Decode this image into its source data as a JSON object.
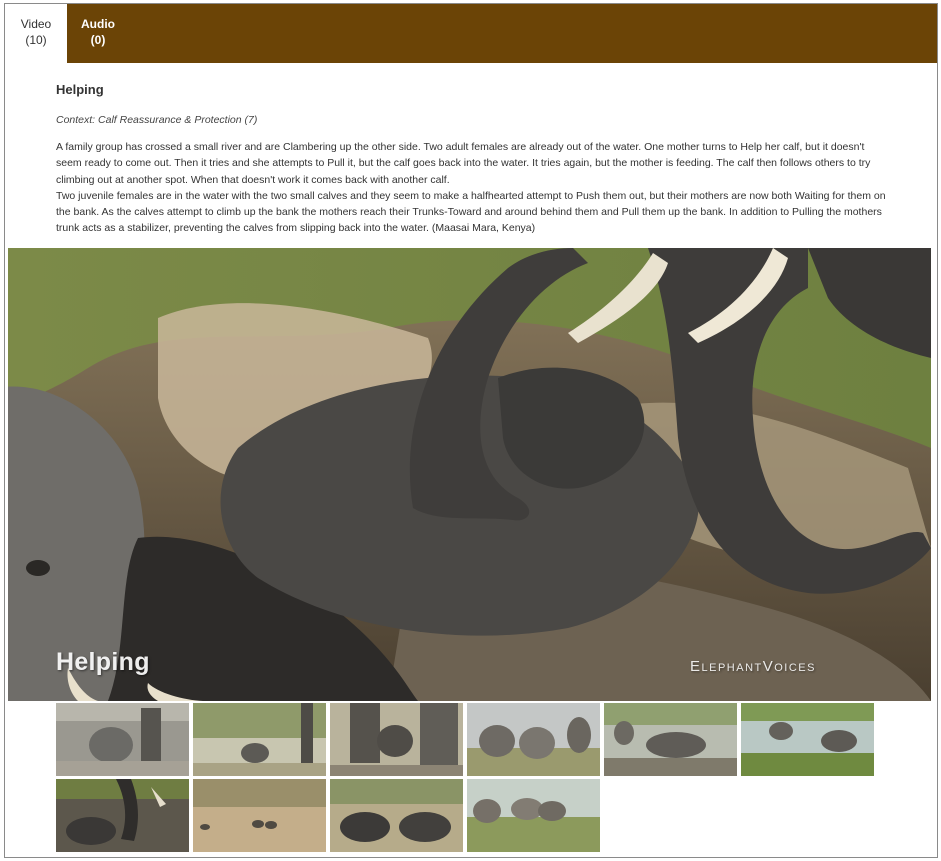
{
  "tabs": [
    {
      "label": "Video",
      "count": "(10)",
      "active": true
    },
    {
      "label": "Audio",
      "count": "(0)",
      "active": false
    }
  ],
  "clip": {
    "title": "Helping",
    "context": "Context: Calf Reassurance & Protection (7)",
    "description": [
      "A family group has crossed a small river and are Clambering up the other side. Two adult females are already out of the water. One mother turns to Help her calf, but it doesn't seem ready to come out. Then it tries and she attempts to Pull it, but the calf goes back into the water. It tries again, but the mother is feeding. The calf then follows others to try climbing out at another spot. When that doesn't work it comes back with another calf.",
      "Two juvenile females are in the water with the two small calves and they seem to make a halfhearted attempt to Push them out, but their mothers are now both Waiting for them on the bank. As the calves attempt to climb up the bank the mothers reach their Trunks-Toward and around behind them and Pull them up the bank. In addition to Pulling the mothers trunk acts as a stabilizer, preventing the calves from slipping back into the water. (Maasai Mara, Kenya)"
    ]
  },
  "player": {
    "overlay_title": "Helping",
    "brand": "ElephantVoices"
  },
  "thumbnail_count": 10,
  "colors": {
    "tab_bar": "#6b4406",
    "frame_border": "#8a8a8a"
  }
}
